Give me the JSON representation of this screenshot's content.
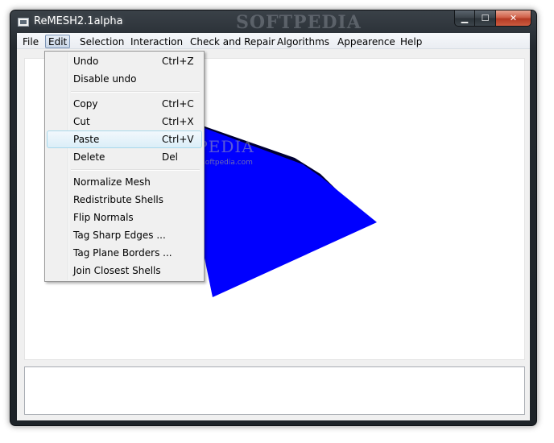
{
  "window": {
    "title": "ReMESH2.1alpha",
    "caption_minimize": "▁",
    "caption_maximize": "☐",
    "caption_close": "✕"
  },
  "menubar": {
    "items": [
      {
        "label": "File"
      },
      {
        "label": "Edit"
      },
      {
        "label": "Selection"
      },
      {
        "label": "Interaction"
      },
      {
        "label": "Check and Repair"
      },
      {
        "label": "Algorithms"
      },
      {
        "label": "Appearence"
      },
      {
        "label": "Help"
      }
    ],
    "open_menu": "Edit"
  },
  "edit_menu": {
    "items": [
      {
        "label": "Undo",
        "shortcut": "Ctrl+Z"
      },
      {
        "label": "Disable undo",
        "shortcut": ""
      },
      {
        "label": "Copy",
        "shortcut": "Ctrl+C"
      },
      {
        "label": "Cut",
        "shortcut": "Ctrl+X"
      },
      {
        "label": "Paste",
        "shortcut": "Ctrl+V"
      },
      {
        "label": "Delete",
        "shortcut": "Del"
      },
      {
        "label": "Normalize Mesh",
        "shortcut": ""
      },
      {
        "label": "Redistribute Shells",
        "shortcut": ""
      },
      {
        "label": "Flip Normals",
        "shortcut": ""
      },
      {
        "label": "Tag Sharp Edges ...",
        "shortcut": ""
      },
      {
        "label": "Tag Plane Borders ...",
        "shortcut": ""
      },
      {
        "label": "Join Closest Shells",
        "shortcut": ""
      }
    ],
    "highlighted": "Paste"
  },
  "viewport": {
    "mesh_color": "#0000ff",
    "mesh_edge_color": "#000033"
  },
  "watermark": {
    "title_text": "SOFTPEDIA",
    "center_text": "SOFTPEDIA",
    "center_url": "www.softpedia.com"
  },
  "colors": {
    "titlebar": "#23292f",
    "close_button": "#c7462c",
    "menu_highlight": "#dbeef8"
  }
}
